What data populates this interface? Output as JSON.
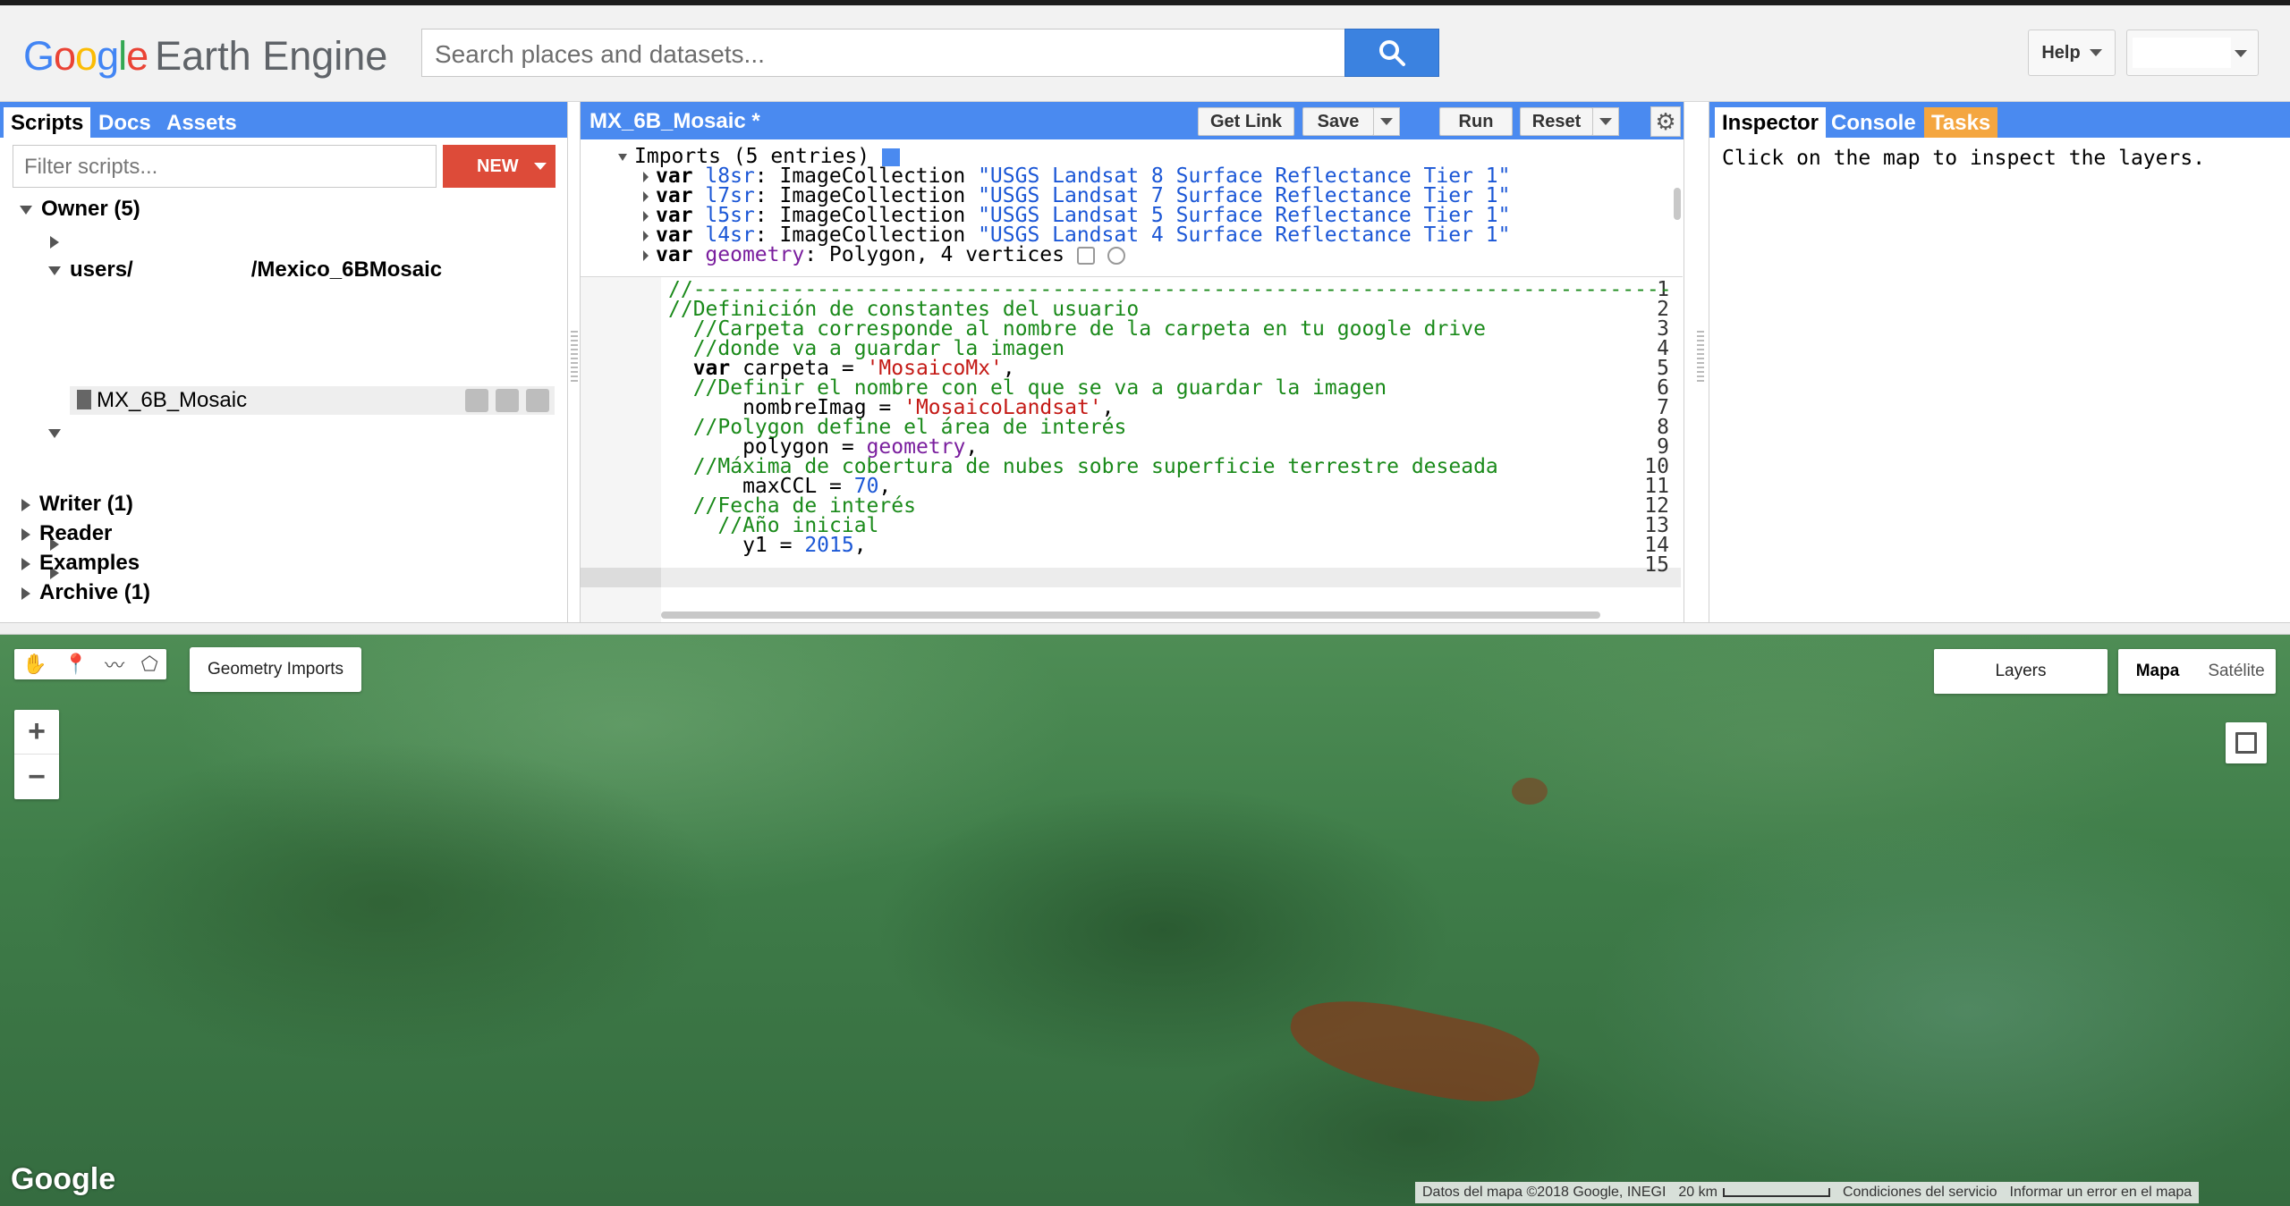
{
  "header": {
    "logo_google": "Google",
    "logo_product": "Earth Engine",
    "search_placeholder": "Search places and datasets...",
    "help_label": "Help"
  },
  "left_panel": {
    "tabs": [
      "Scripts",
      "Docs",
      "Assets"
    ],
    "filter_placeholder": "Filter scripts...",
    "new_label": "NEW",
    "tree": {
      "owner": "Owner",
      "owner_count": "(5)",
      "users_prefix": "users/",
      "users_repo": "/Mexico_6BMosaic",
      "script_name": "MX_6B_Mosaic",
      "writer": "Writer",
      "writer_count": "(1)",
      "reader": "Reader",
      "examples": "Examples",
      "archive": "Archive",
      "archive_count": "(1)"
    }
  },
  "code_panel": {
    "title": "MX_6B_Mosaic *",
    "buttons": {
      "get_link": "Get Link",
      "save": "Save",
      "run": "Run",
      "reset": "Reset"
    },
    "imports_header": "Imports (5 entries)",
    "imports": [
      {
        "kw": "var",
        "name": "l8sr",
        "type": ": ImageCollection",
        "value": "\"USGS Landsat 8 Surface Reflectance Tier 1\""
      },
      {
        "kw": "var",
        "name": "l7sr",
        "type": ": ImageCollection",
        "value": "\"USGS Landsat 7 Surface Reflectance Tier 1\""
      },
      {
        "kw": "var",
        "name": "l5sr",
        "type": ": ImageCollection",
        "value": "\"USGS Landsat 5 Surface Reflectance Tier 1\""
      },
      {
        "kw": "var",
        "name": "l4sr",
        "type": ": ImageCollection",
        "value": "\"USGS Landsat 4 Surface Reflectance Tier 1\""
      },
      {
        "kw": "var",
        "name": "geometry",
        "type": ": Polygon, 4 vertices",
        "value": ""
      }
    ],
    "line_numbers": [
      "1",
      "2",
      "3",
      "4",
      "5",
      "6",
      "7",
      "8",
      "9",
      "10",
      "11",
      "12",
      "13",
      "14",
      "15"
    ],
    "code": {
      "l1": "//-------------------------------------------------------------------------------",
      "l2": "//Definición de constantes del usuario",
      "l3": "  //Carpeta corresponde al nombre de la carpeta en tu google drive",
      "l4": "  //donde va a guardar la imagen",
      "l5_kw": "var",
      "l5_a": " carpeta = ",
      "l5_str": "'MosaicoMx'",
      "l5_b": ",",
      "l6": "  //Definir el nombre con el que se va a guardar la imagen",
      "l7_a": "      nombreImag = ",
      "l7_str": "'MosaicoLandsat'",
      "l7_b": ",",
      "l8": "  //Polygon define el área de interés",
      "l9_a": "      polygon = ",
      "l9_prp": "geometry",
      "l9_b": ",",
      "l10": "  //Máxima de cobertura de nubes sobre superficie terrestre deseada",
      "l11_a": "      maxCCL = ",
      "l11_num": "70",
      "l11_b": ",",
      "l12": "  //Fecha de interés",
      "l13": "    //Año inicial",
      "l14_a": "      y1 = ",
      "l14_num": "2015",
      "l14_b": ","
    }
  },
  "right_panel": {
    "tabs": [
      "Inspector",
      "Console",
      "Tasks"
    ],
    "inspector_text": "Click on the map to inspect the layers."
  },
  "map": {
    "geometry_imports": "Geometry Imports",
    "zoom_in": "+",
    "zoom_out": "−",
    "layers": "Layers",
    "map_types": [
      "Mapa",
      "Satélite"
    ],
    "google_logo": "Google",
    "attribution": "Datos del mapa ©2018 Google, INEGI",
    "scale": "20 km",
    "terms": "Condiciones del servicio",
    "report": "Informar un error en el mapa"
  },
  "colors": {
    "panel_blue": "#4a8af0",
    "new_red": "#dd4b39",
    "search_blue": "#3b82e0",
    "tasks_orange": "#f4a640"
  }
}
